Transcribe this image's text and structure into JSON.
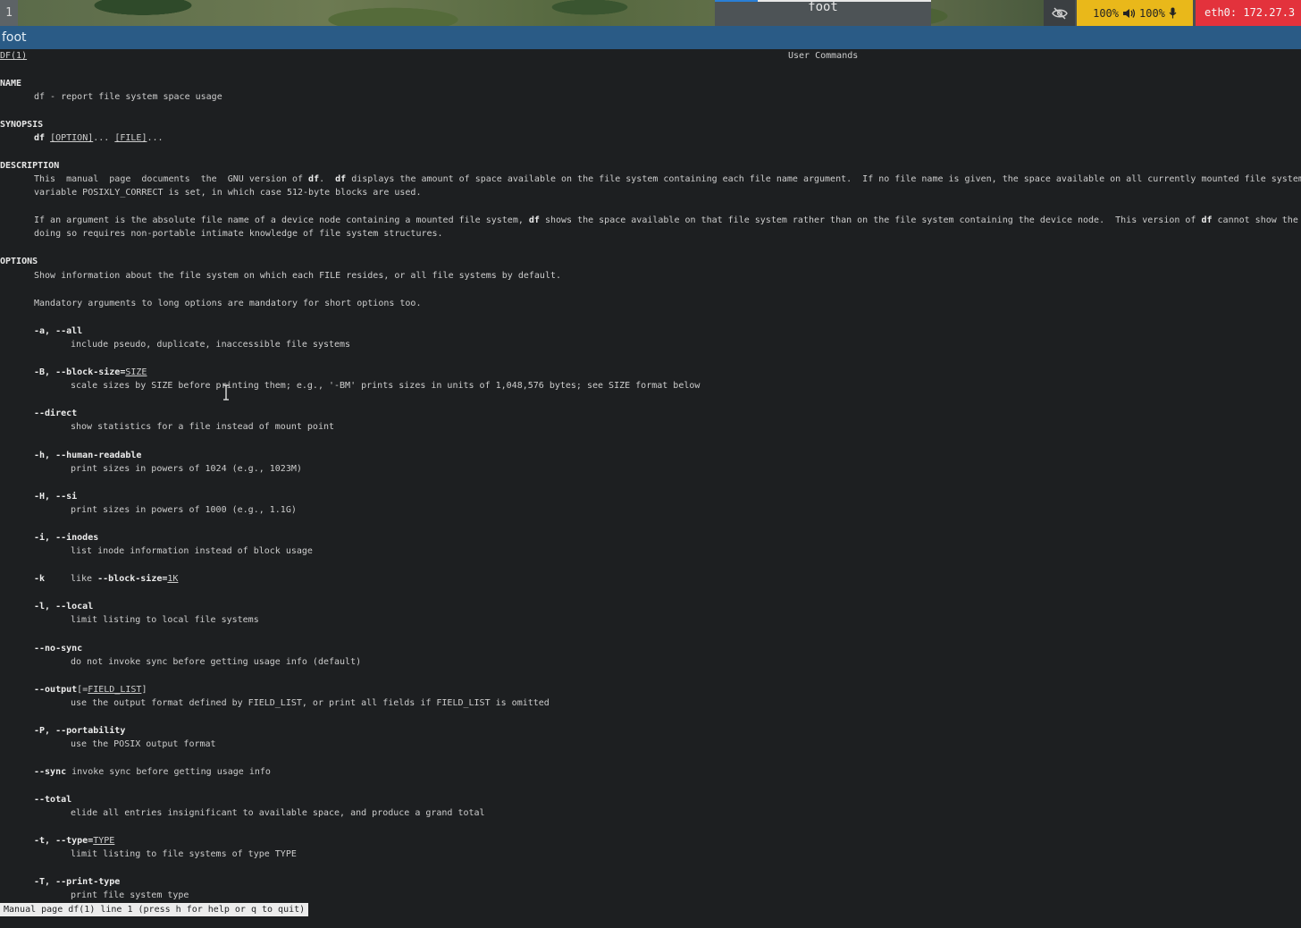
{
  "topbar": {
    "workspace": "1",
    "focused_title": "foot",
    "volume": "100%",
    "mic": "100%",
    "network": "eth0: 172.27.3",
    "icons": [
      "eye-off-icon",
      "speaker-icon",
      "microphone-icon"
    ]
  },
  "window": {
    "title": "foot"
  },
  "manpage": {
    "header_left": "DF(1)",
    "header_center": "User Commands",
    "name_heading": "NAME",
    "name_text": "df - report file system space usage",
    "synopsis_heading": "SYNOPSIS",
    "synopsis_cmd": "df",
    "synopsis_option": "[OPTION]",
    "synopsis_dots1": "...",
    "synopsis_file": "[FILE]",
    "synopsis_dots2": "...",
    "description_heading": "DESCRIPTION",
    "desc_p1_a": "This  manual  page  documents  the  GNU version of ",
    "desc_p1_df1": "df",
    "desc_p1_b": ".  ",
    "desc_p1_df2": "df",
    "desc_p1_c": " displays the amount of space available on the file system containing each file name argument.  If no file name is given, the space available on all currently mounted file systems is shown.",
    "desc_p1_line2": "variable POSIXLY_CORRECT is set, in which case 512-byte blocks are used.",
    "desc_p2_a": "If an argument is the absolute file name of a device node containing a mounted file system, ",
    "desc_p2_df1": "df",
    "desc_p2_b": " shows the space available on that file system rather than on the file system containing the device node.  This version of ",
    "desc_p2_df2": "df",
    "desc_p2_c": " cannot show the space available",
    "desc_p2_line2": "doing so requires non-portable intimate knowledge of file system structures.",
    "options_heading": "OPTIONS",
    "opt_intro1": "Show information about the file system on which each FILE resides, or all file systems by default.",
    "opt_intro2": "Mandatory arguments to long options are mandatory for short options too.",
    "opt_a": "-a, --all",
    "opt_a_desc": "include pseudo, duplicate, inaccessible file systems",
    "opt_B": "-B, --block-size=",
    "opt_B_arg": "SIZE",
    "opt_B_desc": "scale sizes by SIZE before printing them; e.g., '-BM' prints sizes in units of 1,048,576 bytes; see SIZE format below",
    "opt_direct": "--direct",
    "opt_direct_desc": "show statistics for a file instead of mount point",
    "opt_h": "-h, --human-readable",
    "opt_h_desc": "print sizes in powers of 1024 (e.g., 1023M)",
    "opt_H": "-H, --si",
    "opt_H_desc": "print sizes in powers of 1000 (e.g., 1.1G)",
    "opt_i": "-i, --inodes",
    "opt_i_desc": "list inode information instead of block usage",
    "opt_k": "-k",
    "opt_k_desc_a": "like ",
    "opt_k_desc_b": "--block-size=",
    "opt_k_desc_c": "1K",
    "opt_l": "-l, --local",
    "opt_l_desc": "limit listing to local file systems",
    "opt_nosync": "--no-sync",
    "opt_nosync_desc": "do not invoke sync before getting usage info (default)",
    "opt_output": "--output",
    "opt_output_arg_a": "[=",
    "opt_output_arg_b": "FIELD_LIST",
    "opt_output_arg_c": "]",
    "opt_output_desc": "use the output format defined by FIELD_LIST, or print all fields if FIELD_LIST is omitted",
    "opt_P": "-P, --portability",
    "opt_P_desc": "use the POSIX output format",
    "opt_sync": "--sync",
    "opt_sync_desc": " invoke sync before getting usage info",
    "opt_total": "--total",
    "opt_total_desc": "elide all entries insignificant to available space, and produce a grand total",
    "opt_t": "-t, --type=",
    "opt_t_arg": "TYPE",
    "opt_t_desc": "limit listing to file systems of type TYPE",
    "opt_T": "-T, --print-type",
    "opt_T_desc": "print file system type"
  },
  "status": "Manual page df(1) line 1 (press h for help or q to quit)"
}
